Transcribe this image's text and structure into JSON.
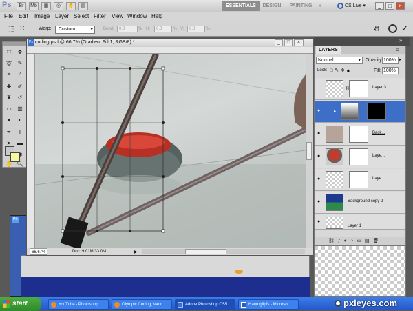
{
  "app": {
    "logo": "Ps",
    "workspaces": [
      "ESSENTIALS",
      "DESIGN",
      "PAINTING",
      "»"
    ],
    "cs_live": "CS Live ▾",
    "window_controls": [
      "_",
      "□",
      "×"
    ]
  },
  "menubar": [
    "File",
    "Edit",
    "Image",
    "Layer",
    "Select",
    "Filter",
    "View",
    "Window",
    "Help"
  ],
  "options": {
    "warp_label": "Warp:",
    "warp_value": "Custom",
    "bend_label": "Bend:",
    "bend_value": "0.0",
    "h_label": "H:",
    "h_value": "0.0",
    "v_label": "V:",
    "v_value": "0.0",
    "pct": "%"
  },
  "document": {
    "title": "curling.psd @ 66.7% (Gradient Fill 1, RGB/8) *",
    "zoom": "66.67%",
    "doc_size": "Doc: 9.01M/33.0M"
  },
  "layers_panel": {
    "tab": "LAYERS",
    "blend_mode": "Normal",
    "opacity_label": "Opacity:",
    "opacity_value": "100%",
    "lock_label": "Lock:",
    "fill_label": "Fill:",
    "fill_value": "100%",
    "layers": [
      {
        "name": "Layer 3",
        "visible": false
      },
      {
        "name": "",
        "visible": true,
        "selected": true
      },
      {
        "name": "Back...",
        "visible": true
      },
      {
        "name": "Laye...",
        "visible": true
      },
      {
        "name": "Laye...",
        "visible": true
      },
      {
        "name": "Background copy 2",
        "visible": true
      },
      {
        "name": "Layer 1",
        "visible": true
      }
    ]
  },
  "taskbar": {
    "start": "start",
    "tasks": [
      "YouTube - Photoshop...",
      "Olympic Curling, Vanc...",
      "Adobe Photoshop CS5",
      "Haeroglipfs - Microso..."
    ],
    "watermark": "pxleyes.com"
  },
  "colors": {
    "accent": "#3d6ec8",
    "stone_red": "#c8392b",
    "stone_gray": "#5a6766",
    "taskbar": "#2456c8"
  }
}
